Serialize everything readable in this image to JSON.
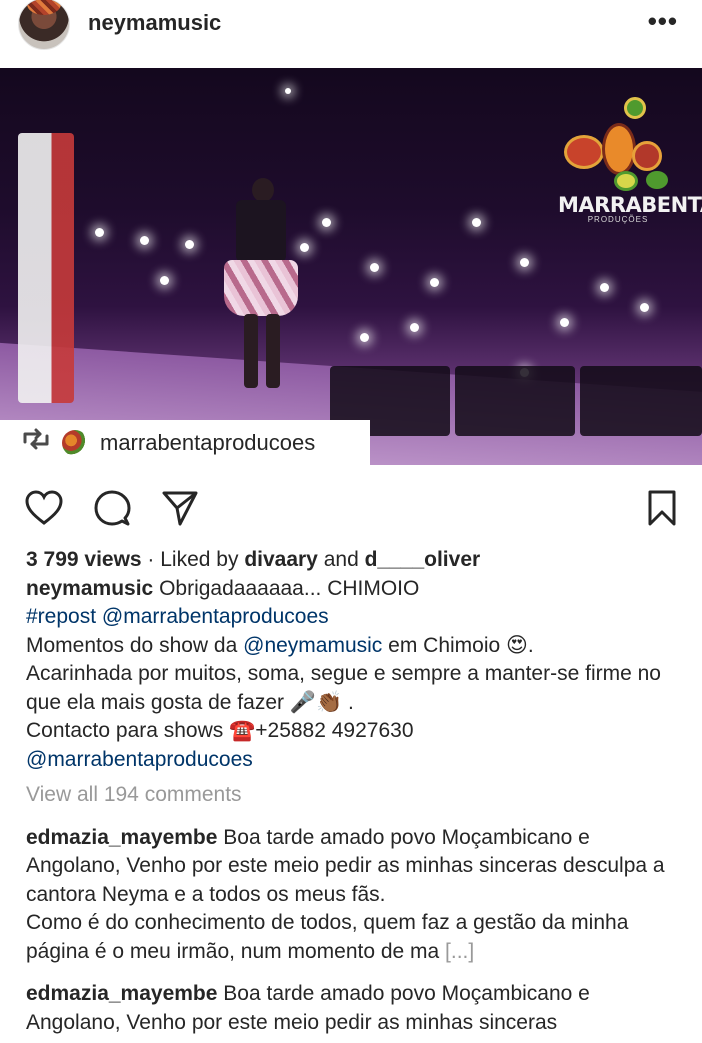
{
  "header": {
    "username": "neymamusic",
    "more_glyph": "•••"
  },
  "media": {
    "brand_name": "MARRABENTA",
    "brand_sub": "PRODUÇÕES",
    "repost_icon": "repost-icon",
    "repost_handle": "marrabentaproducoes"
  },
  "actions": {
    "icons": [
      "heart-icon",
      "comment-icon",
      "share-icon",
      "bookmark-icon"
    ]
  },
  "stats": {
    "views": "3 799 views",
    "separator": " · Liked by ",
    "liker1": "divaary",
    "and": " and ",
    "liker2": "d____oliver"
  },
  "caption": {
    "author": "neymamusic",
    "line1": " Obrigadaaaaaa... CHIMOIO",
    "hashtag": "#repost",
    "mention1": "@marrabentaproducoes",
    "line3_pre": "Momentos do show da ",
    "line3_mention": "@neymamusic",
    "line3_post": " em Chimoio 😍.",
    "line4": "Acarinhada por muitos, soma, segue e sempre a manter-se firme no que ela mais gosta de fazer 🎤👏🏾 .",
    "line5": "Contacto para shows ☎️+25882 4927630",
    "mention2": "@marrabentaproducoes"
  },
  "view_all_comments": "View all 194 comments",
  "comments": [
    {
      "author": "edmazia_mayembe",
      "text": " Boa tarde amado povo Moçambicano e Angolano, Venho por este meio pedir as minhas sinceras desculpa a cantora Neyma e a todos os meus fãs.",
      "text2": "Como é do conhecimento de todos, quem faz a gestão da minha página é o meu irmão, num momento de ma ",
      "more": "[...]"
    },
    {
      "author": "edmazia_mayembe",
      "text": " Boa tarde amado povo Moçambicano e Angolano, Venho por este meio pedir as minhas sinceras"
    }
  ],
  "colors": {
    "text": "#262626",
    "link": "#003569",
    "muted": "#999999"
  }
}
